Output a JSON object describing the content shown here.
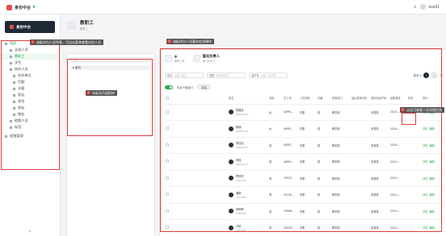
{
  "header": {
    "app_name": "身份中台",
    "user_name": "test01"
  },
  "sidebar": {
    "brand": "身份中台",
    "items": [
      {
        "label": "组织",
        "kind": "group"
      },
      {
        "label": "全部人员",
        "kind": "sub"
      },
      {
        "label": "教职工",
        "kind": "active"
      },
      {
        "label": "学生",
        "kind": "sub"
      },
      {
        "label": "校外人员",
        "kind": "sub"
      },
      {
        "label": "合作单位",
        "kind": "sub2"
      },
      {
        "label": "后勤",
        "kind": "sub2"
      },
      {
        "label": "访客",
        "kind": "sub2"
      },
      {
        "label": "家长",
        "kind": "sub2"
      },
      {
        "label": "承包",
        "kind": "sub2"
      },
      {
        "label": "校友",
        "kind": "sub2"
      },
      {
        "label": "物业",
        "kind": "sub2"
      },
      {
        "label": "假期人员",
        "kind": "sub"
      },
      {
        "label": "标签",
        "kind": "sub"
      },
      {
        "label": "权限管理",
        "kind": "group2"
      }
    ],
    "collapse": "«"
  },
  "page": {
    "title": "教职工",
    "subtitle": "教职工"
  },
  "tree": {
    "search_placeholder": "搜索",
    "root_node": "▸ 组织"
  },
  "stats": [
    {
      "value": "9",
      "label": "教职工数"
    },
    {
      "value": "暂无负责人",
      "label": "部门负责人"
    }
  ],
  "filters": [
    {
      "label": "姓名",
      "placeholder": "请输入姓名"
    },
    {
      "label": "性别",
      "placeholder": "请选择性别"
    },
    {
      "label": "证件号",
      "placeholder": "请输入证件号"
    }
  ],
  "filter_more": "更多 ▾",
  "toolbar": {
    "toggle_label": "包含下级部门",
    "export": "导出"
  },
  "table": {
    "headers": [
      "姓名",
      "性别",
      "学工号",
      "人员类型",
      "在编",
      "所属部门",
      "最后登录时间",
      "身份验证时间",
      "最新登录",
      "状态",
      "操作"
    ],
    "rows": [
      {
        "name": "陈国松",
        "id": "LWPQ2136",
        "sex": "女",
        "no": "LWPQ...",
        "type": "在职",
        "status": "是",
        "dept": "教学部",
        "v1": "未登录",
        "t": "2024-..."
      },
      {
        "name": "杨涛",
        "id": "LWPQ2149",
        "sex": "女",
        "no": "LWPQ...",
        "type": "在职",
        "status": "是",
        "dept": "教学部",
        "v1": "未登录",
        "t": "2024-..."
      },
      {
        "name": "李佳佳",
        "id": "LWPQ2137",
        "sex": "男",
        "no": "LWPQ...",
        "type": "在职",
        "status": "是",
        "dept": "教学部",
        "v1": "未登录",
        "t": "2024-..."
      },
      {
        "name": "何桂",
        "id": "LWPQ2141",
        "sex": "男",
        "no": "LWPQ...",
        "type": "在职",
        "status": "是",
        "dept": "教学部",
        "v1": "未登录",
        "t": "2024-..."
      },
      {
        "name": "曹欣欣",
        "id": "1952201",
        "sex": "男",
        "no": "19522...",
        "type": "在职",
        "status": "是",
        "dept": "教学部",
        "v1": "未登录",
        "t": "2024-..."
      },
      {
        "name": "潘新",
        "id": "2014064",
        "sex": "男",
        "no": "20140...",
        "type": "在职",
        "status": "是",
        "dept": "教学部",
        "v1": "未登录",
        "t": "2024-..."
      },
      {
        "name": "邓秋莉",
        "id": "1998602",
        "sex": "男",
        "no": "19986...",
        "type": "在职",
        "status": "是",
        "dept": "教学部",
        "v1": "未登录",
        "t": "2024-..."
      },
      {
        "name": "卢婧",
        "id": "2003645",
        "sex": "男",
        "no": "20036...",
        "type": "在职",
        "status": "是",
        "dept": "教学部",
        "v1": "未登录",
        "t": "2024-..."
      }
    ],
    "op_detail": "详情",
    "op_edit": "编辑"
  },
  "annotations": {
    "a1_num": "1",
    "a1": "该板块为人员列表，可点击菜单查看对应人员",
    "a2_num": "2",
    "a2": "该板块为人员基本信息模块",
    "a3_num": "3",
    "a3": "本板块为组织树",
    "a4_num": "4",
    "a4": "点击可查看人员详细信息"
  }
}
